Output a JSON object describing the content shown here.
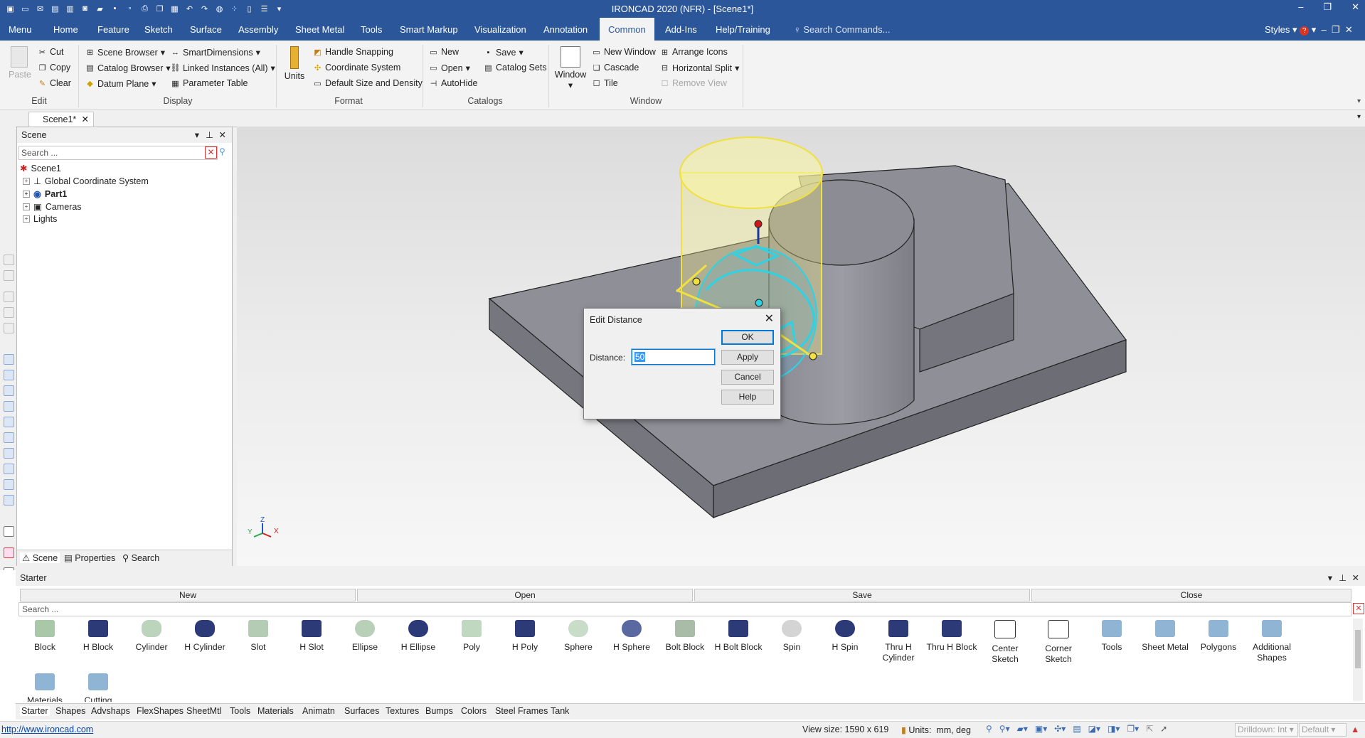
{
  "app": {
    "title": "IRONCAD 2020 (NFR) - [Scene1*]"
  },
  "menu_tabs": [
    "Menu",
    "Home",
    "Feature",
    "Sketch",
    "Surface",
    "Assembly",
    "Sheet Metal",
    "Tools",
    "Smart Markup",
    "Visualization",
    "Annotation",
    "Common",
    "Add-Ins",
    "Help/Training"
  ],
  "active_tab": "Common",
  "search_commands_placeholder": "Search Commands...",
  "styles_label": "Styles",
  "ribbon": {
    "edit": {
      "paste": "Paste",
      "cut": "Cut",
      "copy": "Copy",
      "clear": "Clear",
      "group": "Edit"
    },
    "display": {
      "scene_browser": "Scene Browser",
      "catalog_browser": "Catalog Browser",
      "datum_plane": "Datum Plane",
      "smart_dimensions": "SmartDimensions",
      "linked_instances": "Linked Instances (All)",
      "parameter_table": "Parameter Table",
      "group": "Display"
    },
    "format": {
      "units": "Units",
      "handle_snapping": "Handle Snapping",
      "coordinate_system": "Coordinate System",
      "default_size": "Default Size and Density",
      "group": "Format"
    },
    "catalogs": {
      "new": "New",
      "open": "Open",
      "autohide": "AutoHide",
      "save": "Save",
      "catalog_sets": "Catalog Sets",
      "group": "Catalogs"
    },
    "window": {
      "window": "Window",
      "new_window": "New Window",
      "cascade": "Cascade",
      "tile": "Tile",
      "arrange_icons": "Arrange Icons",
      "horizontal_split": "Horizontal Split",
      "remove_view": "Remove View",
      "group": "Window"
    }
  },
  "doc_tab": "Scene1*",
  "scene_panel": {
    "title": "Scene",
    "search_placeholder": "Search ...",
    "tree": [
      "Scene1",
      "Global Coordinate System",
      "Part1",
      "Cameras",
      "Lights"
    ],
    "tabs": [
      "Scene",
      "Properties",
      "Search"
    ]
  },
  "dialog": {
    "title": "Edit Distance",
    "distance_label": "Distance:",
    "distance_value": "50",
    "ok": "OK",
    "apply": "Apply",
    "cancel": "Cancel",
    "help": "Help"
  },
  "triad": {
    "z": "Z",
    "y": "Y",
    "x": "X"
  },
  "starter": {
    "title": "Starter",
    "buttons": [
      "New",
      "Open",
      "Save",
      "Close"
    ],
    "search_placeholder": "Search ...",
    "shapes": [
      "Block",
      "H Block",
      "Cylinder",
      "H Cylinder",
      "Slot",
      "H Slot",
      "Ellipse",
      "H Ellipse",
      "Poly",
      "H Poly",
      "Sphere",
      "H Sphere",
      "Bolt Block",
      "H Bolt Block",
      "Spin",
      "H Spin",
      "Thru H Cylinder",
      "Thru H Block",
      "Center Sketch",
      "Corner Sketch",
      "Tools",
      "Sheet Metal",
      "Polygons",
      "Additional Shapes",
      "Materials",
      "Cutting"
    ],
    "tabs": [
      "Starter",
      "Shapes",
      "Advshaps",
      "FlexShapes",
      "SheetMtl",
      "Tools",
      "Materials",
      "Animatn",
      "Surfaces",
      "Textures",
      "Bumps",
      "Colors",
      "Steel Frames",
      "Tank"
    ]
  },
  "status": {
    "url": "http://www.ironcad.com",
    "view_size": "View size: 1590 x  619",
    "units_label": "Units:",
    "units_value": "mm, deg",
    "drilldown": "Drilldown: Int",
    "default": "Default"
  }
}
